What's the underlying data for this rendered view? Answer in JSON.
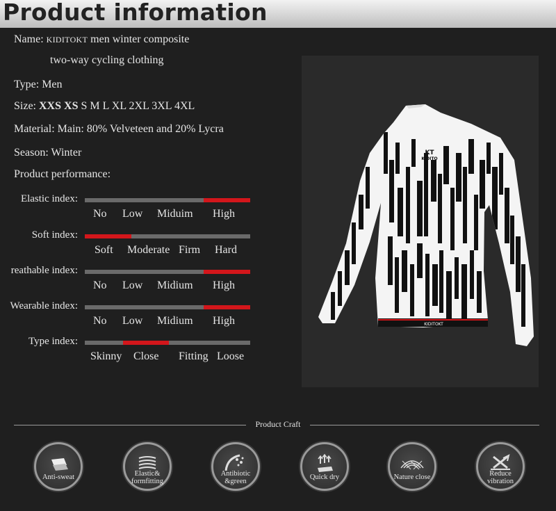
{
  "header": {
    "title": "Product information"
  },
  "info": {
    "name_label": "Name:",
    "name_brand": "KIDITOKT",
    "name_rest": "men winter composite",
    "name_line2": "two-way cycling clothing",
    "type": "Type: Men",
    "size_label": "Size:",
    "sizes_bold": "XXS XS",
    "sizes_rest": "S M L XL 2XL 3XL 4XL",
    "material": "Material: Main: 80% Velveteen and 20% Lycra",
    "season": "Season: Winter",
    "performance": "Product performance:"
  },
  "indexes": [
    {
      "label": "Elastic index:",
      "levels": [
        "No",
        "Low",
        "Miduim",
        "High"
      ],
      "selected": "High",
      "fill_fraction": [
        0.72,
        1.0
      ]
    },
    {
      "label": "Soft index:",
      "levels": [
        "Soft",
        "Moderate",
        "Firm",
        "Hard"
      ],
      "selected": "Soft",
      "fill_fraction": [
        0.0,
        0.28
      ]
    },
    {
      "label": "reathable index:",
      "levels": [
        "No",
        "Low",
        "Midium",
        "High"
      ],
      "selected": "High",
      "fill_fraction": [
        0.72,
        1.0
      ]
    },
    {
      "label": "Wearable index:",
      "levels": [
        "No",
        "Low",
        "Midium",
        "High"
      ],
      "selected": "High",
      "fill_fraction": [
        0.72,
        1.0
      ]
    },
    {
      "label": "Type index:",
      "levels": [
        "Skinny",
        "Close",
        "Fitting",
        "Loose"
      ],
      "selected": "Close",
      "fill_fraction": [
        0.23,
        0.51
      ]
    }
  ],
  "product_image": {
    "logo_text": "KIDITO",
    "hem_text": "KIDITOKT"
  },
  "craft": {
    "title": "Product Craft",
    "features": [
      {
        "label": "Anti-sweat",
        "icon": "anti-sweat-icon"
      },
      {
        "label": "Elastic&\nformfitting",
        "icon": "elastic-icon"
      },
      {
        "label": "Antibiotic\n&green",
        "icon": "antibiotic-icon"
      },
      {
        "label": "Quick dry",
        "icon": "quick-dry-icon"
      },
      {
        "label": "Nature close",
        "icon": "nature-close-icon"
      },
      {
        "label": "Reduce\nvibration",
        "icon": "reduce-vibration-icon"
      }
    ]
  },
  "colors": {
    "accent": "#d3161b",
    "bar_track": "#6a6a6a",
    "background": "#1f1f1f"
  }
}
